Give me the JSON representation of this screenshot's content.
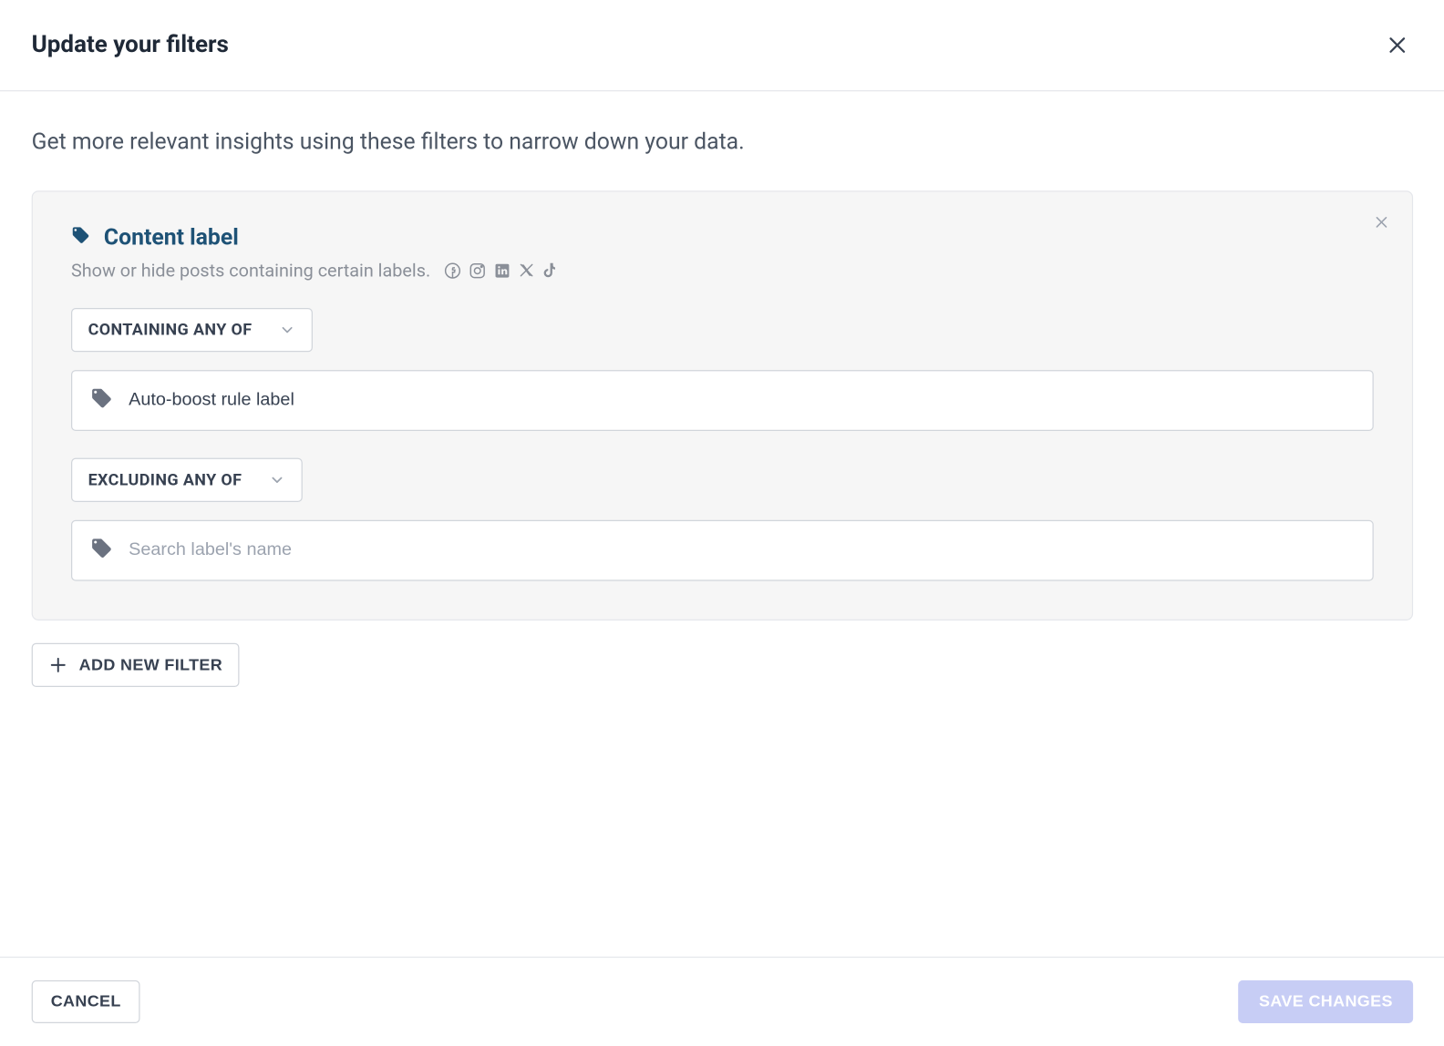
{
  "header": {
    "title": "Update your filters"
  },
  "body": {
    "subtitle": "Get more relevant insights using these filters to narrow down your data."
  },
  "filter": {
    "title": "Content label",
    "description": "Show or hide posts containing certain labels.",
    "containing": {
      "dropdown_label": "CONTAINING ANY OF",
      "value": "Auto-boost rule label"
    },
    "excluding": {
      "dropdown_label": "EXCLUDING ANY OF",
      "placeholder": "Search label's name"
    }
  },
  "buttons": {
    "add_filter": "ADD NEW FILTER",
    "cancel": "CANCEL",
    "save": "SAVE CHANGES"
  }
}
